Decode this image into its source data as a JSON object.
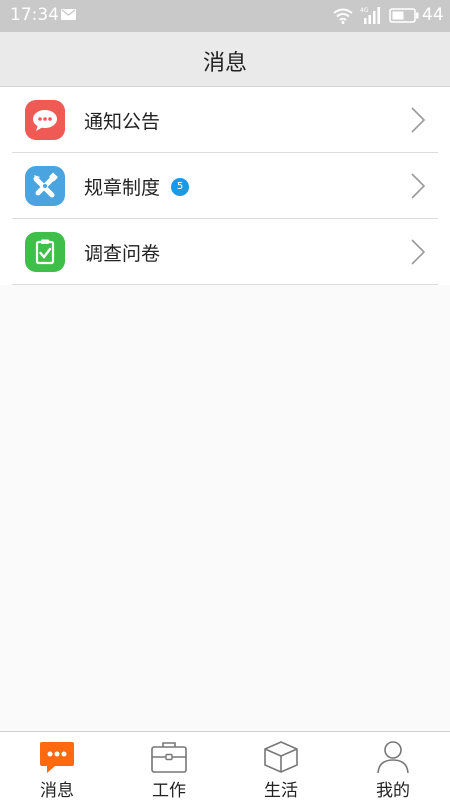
{
  "status_bar": {
    "time": "17:34",
    "battery": "44"
  },
  "header": {
    "title": "消息"
  },
  "list": {
    "items": [
      {
        "label": "通知公告",
        "icon": "chat-bubble-icon",
        "color": "#ef5a55"
      },
      {
        "label": "规章制度",
        "icon": "tools-icon",
        "color": "#4aa4e0",
        "badge": "5"
      },
      {
        "label": "调查问卷",
        "icon": "clipboard-check-icon",
        "color": "#3fbf4a"
      }
    ]
  },
  "tabs": {
    "items": [
      {
        "label": "消息",
        "icon": "message-icon",
        "active": true
      },
      {
        "label": "工作",
        "icon": "briefcase-icon"
      },
      {
        "label": "生活",
        "icon": "box-icon"
      },
      {
        "label": "我的",
        "icon": "user-icon"
      }
    ],
    "active_color": "#ff6a10"
  }
}
